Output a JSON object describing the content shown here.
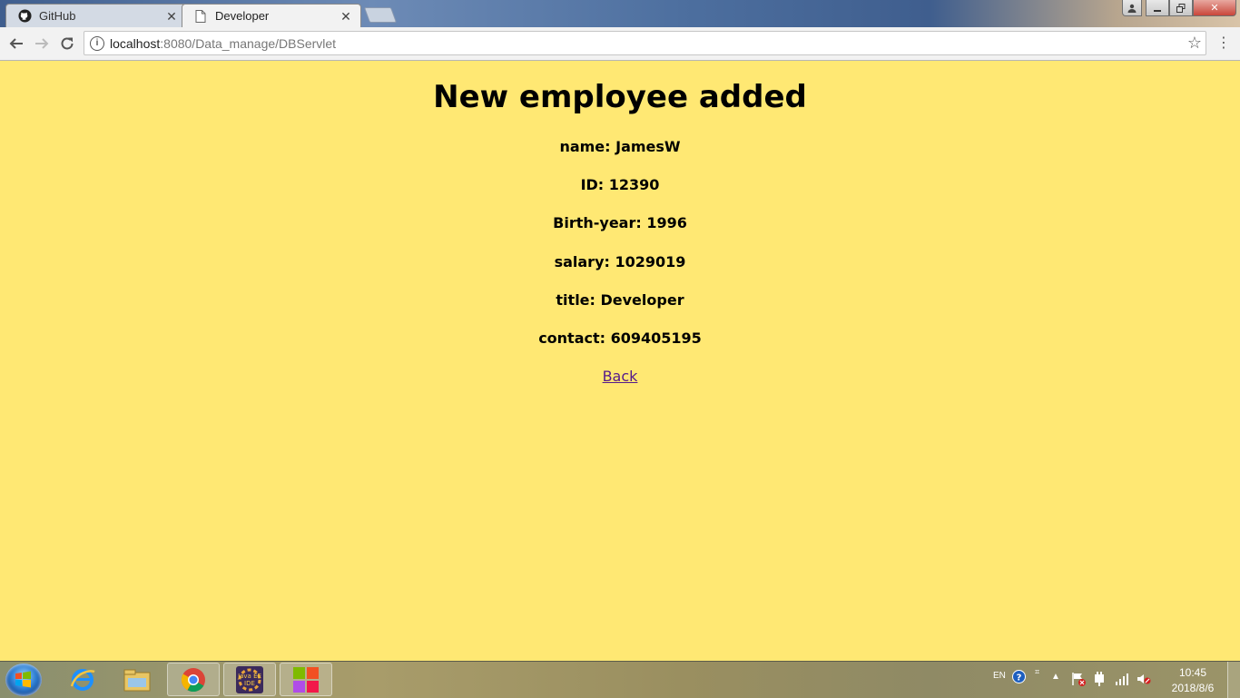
{
  "browser": {
    "tabs": [
      {
        "title": "GitHub",
        "icon": "github-icon",
        "active": false
      },
      {
        "title": "Developer",
        "icon": "page-icon",
        "active": true
      }
    ],
    "url_host": "localhost",
    "url_rest": ":8080/Data_manage/DBServlet"
  },
  "page": {
    "heading": "New employee added",
    "fields": [
      "name: JamesW",
      "ID: 12390",
      "Birth-year: 1996",
      "salary: 1029019",
      "title: Developer",
      "contact: 609405195"
    ],
    "back_link": "Back",
    "background_color": "#ffe873",
    "link_color": "#551a8b"
  },
  "taskbar": {
    "apps": [
      "start-button",
      "internet-explorer-icon",
      "file-explorer-icon",
      "chrome-icon",
      "java-ee-ide-icon",
      "colored-squares-app-icon"
    ],
    "java_ide_label": "Java EE IDE",
    "tray_language": "EN",
    "clock_time": "10:45",
    "clock_date": "2018/8/6"
  }
}
